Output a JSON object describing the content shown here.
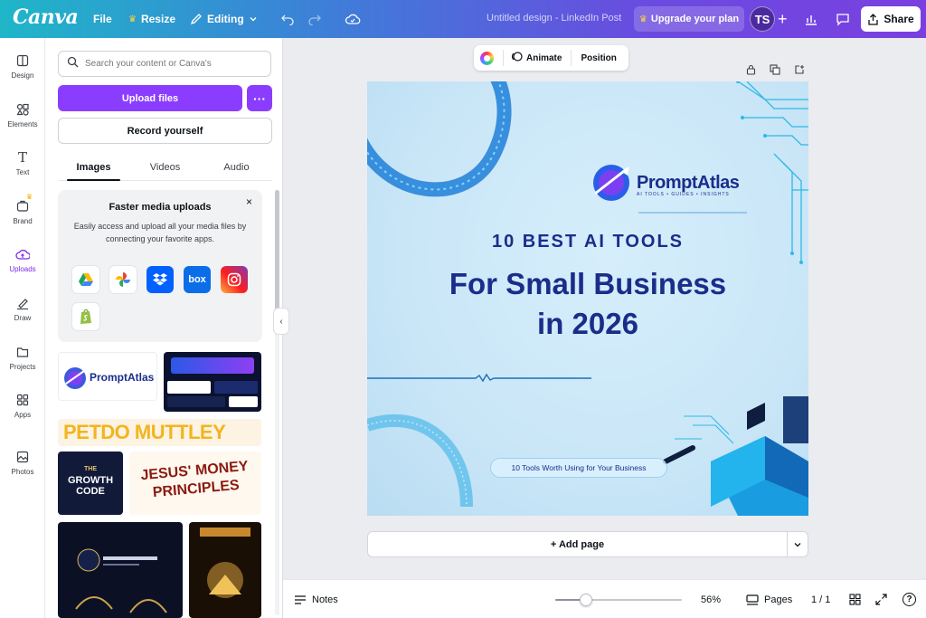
{
  "app": {
    "logo": "Canva"
  },
  "topbar": {
    "file_label": "File",
    "resize_label": "Resize",
    "editing_label": "Editing",
    "doc_title": "Untitled design - LinkedIn Post",
    "upgrade_label": "Upgrade your plan",
    "avatar_initials": "TS",
    "share_label": "Share"
  },
  "rail": {
    "items": [
      {
        "label": "Design",
        "icon": "design-icon"
      },
      {
        "label": "Elements",
        "icon": "elements-icon"
      },
      {
        "label": "Text",
        "icon": "text-icon"
      },
      {
        "label": "Brand",
        "icon": "brand-icon"
      },
      {
        "label": "Uploads",
        "icon": "uploads-icon",
        "active": true
      },
      {
        "label": "Draw",
        "icon": "draw-icon"
      },
      {
        "label": "Projects",
        "icon": "projects-icon"
      },
      {
        "label": "Apps",
        "icon": "apps-icon"
      },
      {
        "label": "Photos",
        "icon": "photos-icon"
      }
    ]
  },
  "panel": {
    "search_placeholder": "Search your content or Canva's",
    "upload_label": "Upload files",
    "more_label": "···",
    "record_label": "Record yourself",
    "tabs": [
      {
        "label": "Images",
        "active": true
      },
      {
        "label": "Videos"
      },
      {
        "label": "Audio"
      }
    ],
    "promo": {
      "title": "Faster media uploads",
      "body": "Easily access and upload all your media files by connecting your favorite apps.",
      "close": "×",
      "apps": [
        "google-drive-icon",
        "google-photos-icon",
        "dropbox-icon",
        "box-icon",
        "instagram-icon",
        "shopify-icon"
      ],
      "box_text": "box"
    },
    "thumbs": {
      "promptatlas": "PromptAtlas",
      "petdo": "PETDO MUTTLEY",
      "growth_code_line1": "THE",
      "growth_code_line2": "GROWTH",
      "growth_code_line3": "CODE",
      "jesus_money_line1": "JESUS' MONEY",
      "jesus_money_line2": "PRINCIPLES"
    }
  },
  "canvas_toolbar": {
    "animate_label": "Animate",
    "position_label": "Position"
  },
  "design": {
    "brand_name": "PromptAtlas",
    "brand_tagline": "AI TOOLS • GUIDES • INSIGHTS",
    "headline_small": "10 BEST AI TOOLS",
    "headline_line1": "For Small Business",
    "headline_line2": "in 2026",
    "pill_text": "10 Tools Worth Using for Your Business"
  },
  "add_page_label": "+ Add page",
  "bottombar": {
    "notes_label": "Notes",
    "zoom_value": 56,
    "zoom_label": "56%",
    "pages_label": "Pages",
    "page_indicator": "1 / 1"
  },
  "colors": {
    "accent": "#8b3dff",
    "headline": "#1a2d8a"
  }
}
